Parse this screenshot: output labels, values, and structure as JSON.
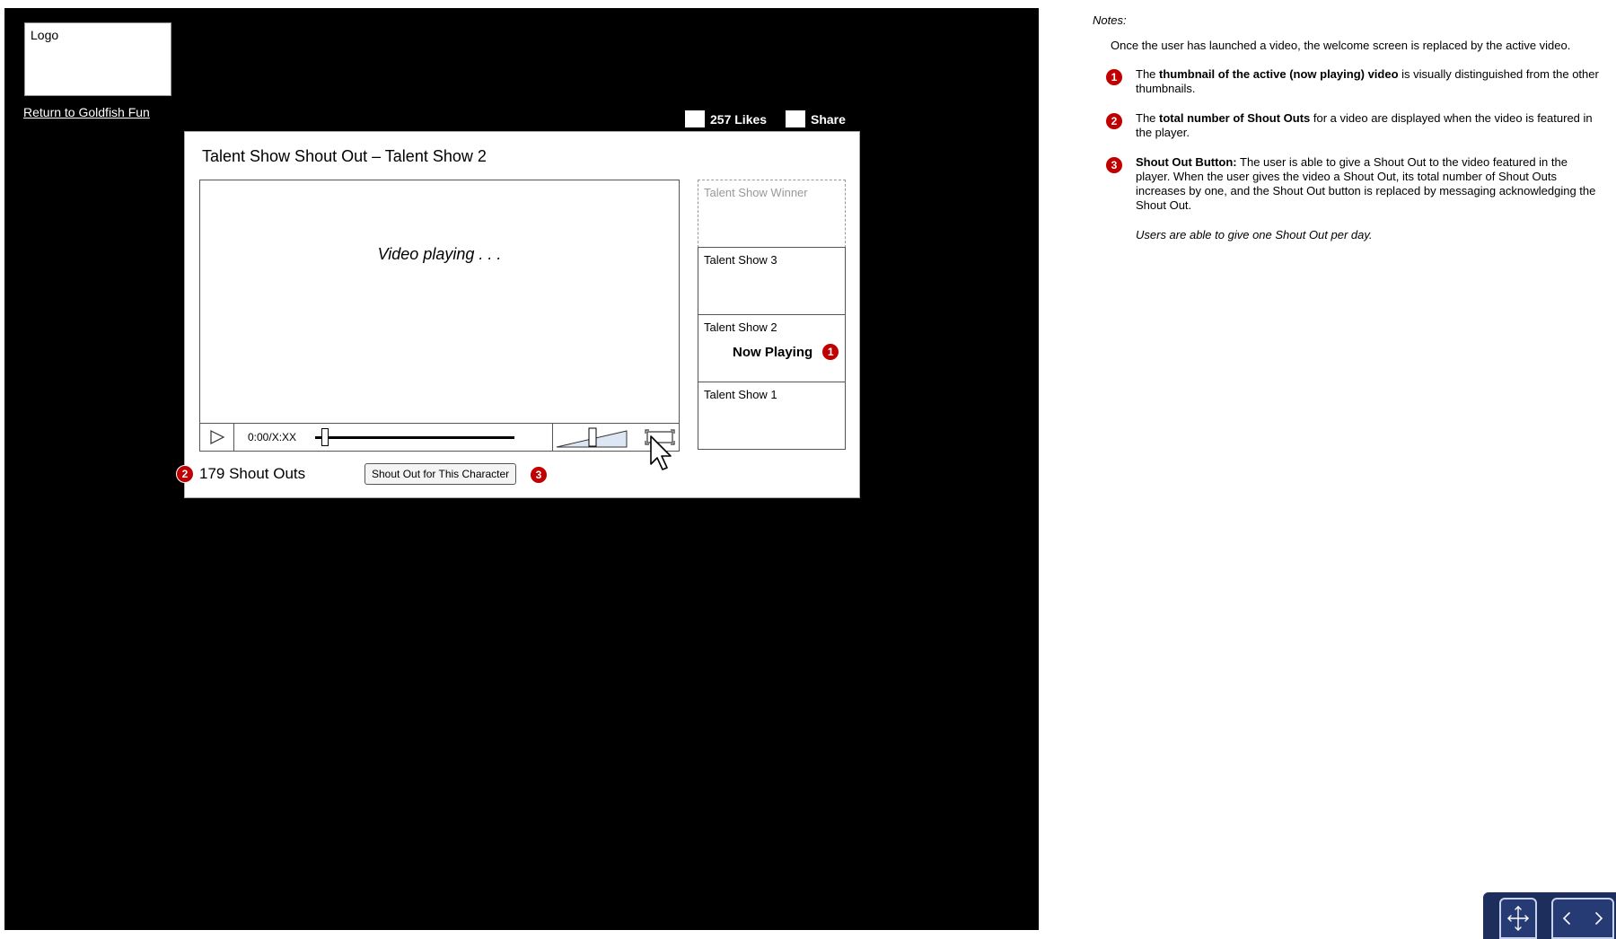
{
  "logo": {
    "label": "Logo"
  },
  "return_link": "Return to Goldfish Fun",
  "social": {
    "likes": "257 Likes",
    "share": "Share"
  },
  "player": {
    "title": "Talent Show Shout Out – Talent Show 2",
    "video_status": "Video playing . . .",
    "time": "0:00/X:XX",
    "seek_fraction": 0.05
  },
  "playlist": [
    {
      "label": "Talent Show Winner"
    },
    {
      "label": "Talent Show 3"
    },
    {
      "label": "Talent Show 2"
    },
    {
      "label": "Talent Show 1"
    }
  ],
  "now_playing": "Now Playing",
  "shout_outs": {
    "count_label": "179 Shout Outs",
    "button": "Shout Out for This Character"
  },
  "badges": {
    "b1": "1",
    "b2": "2",
    "b3": "3"
  },
  "notes": {
    "heading": "Notes:",
    "intro": "Once the user has launched a video, the welcome screen is replaced by the active video.",
    "items": [
      {
        "pre": "The ",
        "bold": "thumbnail of the active (now playing) video",
        "post": " is visually distinguished from the other thumbnails."
      },
      {
        "pre": "The ",
        "bold": "total number of Shout Outs",
        "post": " for a video are displayed when the video is featured in the player."
      },
      {
        "pre": "",
        "bold": "Shout Out Button:",
        "post": " The user is able to give a Shout Out to the video featured in the player.  When the user gives the video a Shout Out, its total number of Shout Outs increases by one, and the Shout Out button is replaced by messaging acknowledging the Shout Out."
      }
    ],
    "sub_note": "Users are able to give one Shout Out per day."
  },
  "colors": {
    "badge": "#c00000",
    "stage": "#000000",
    "nav": "#1e2e5c"
  },
  "icons": [
    "play-icon",
    "volume-slider-icon",
    "fullscreen-icon",
    "cursor-icon",
    "expand-icon",
    "prev-next-icon"
  ]
}
